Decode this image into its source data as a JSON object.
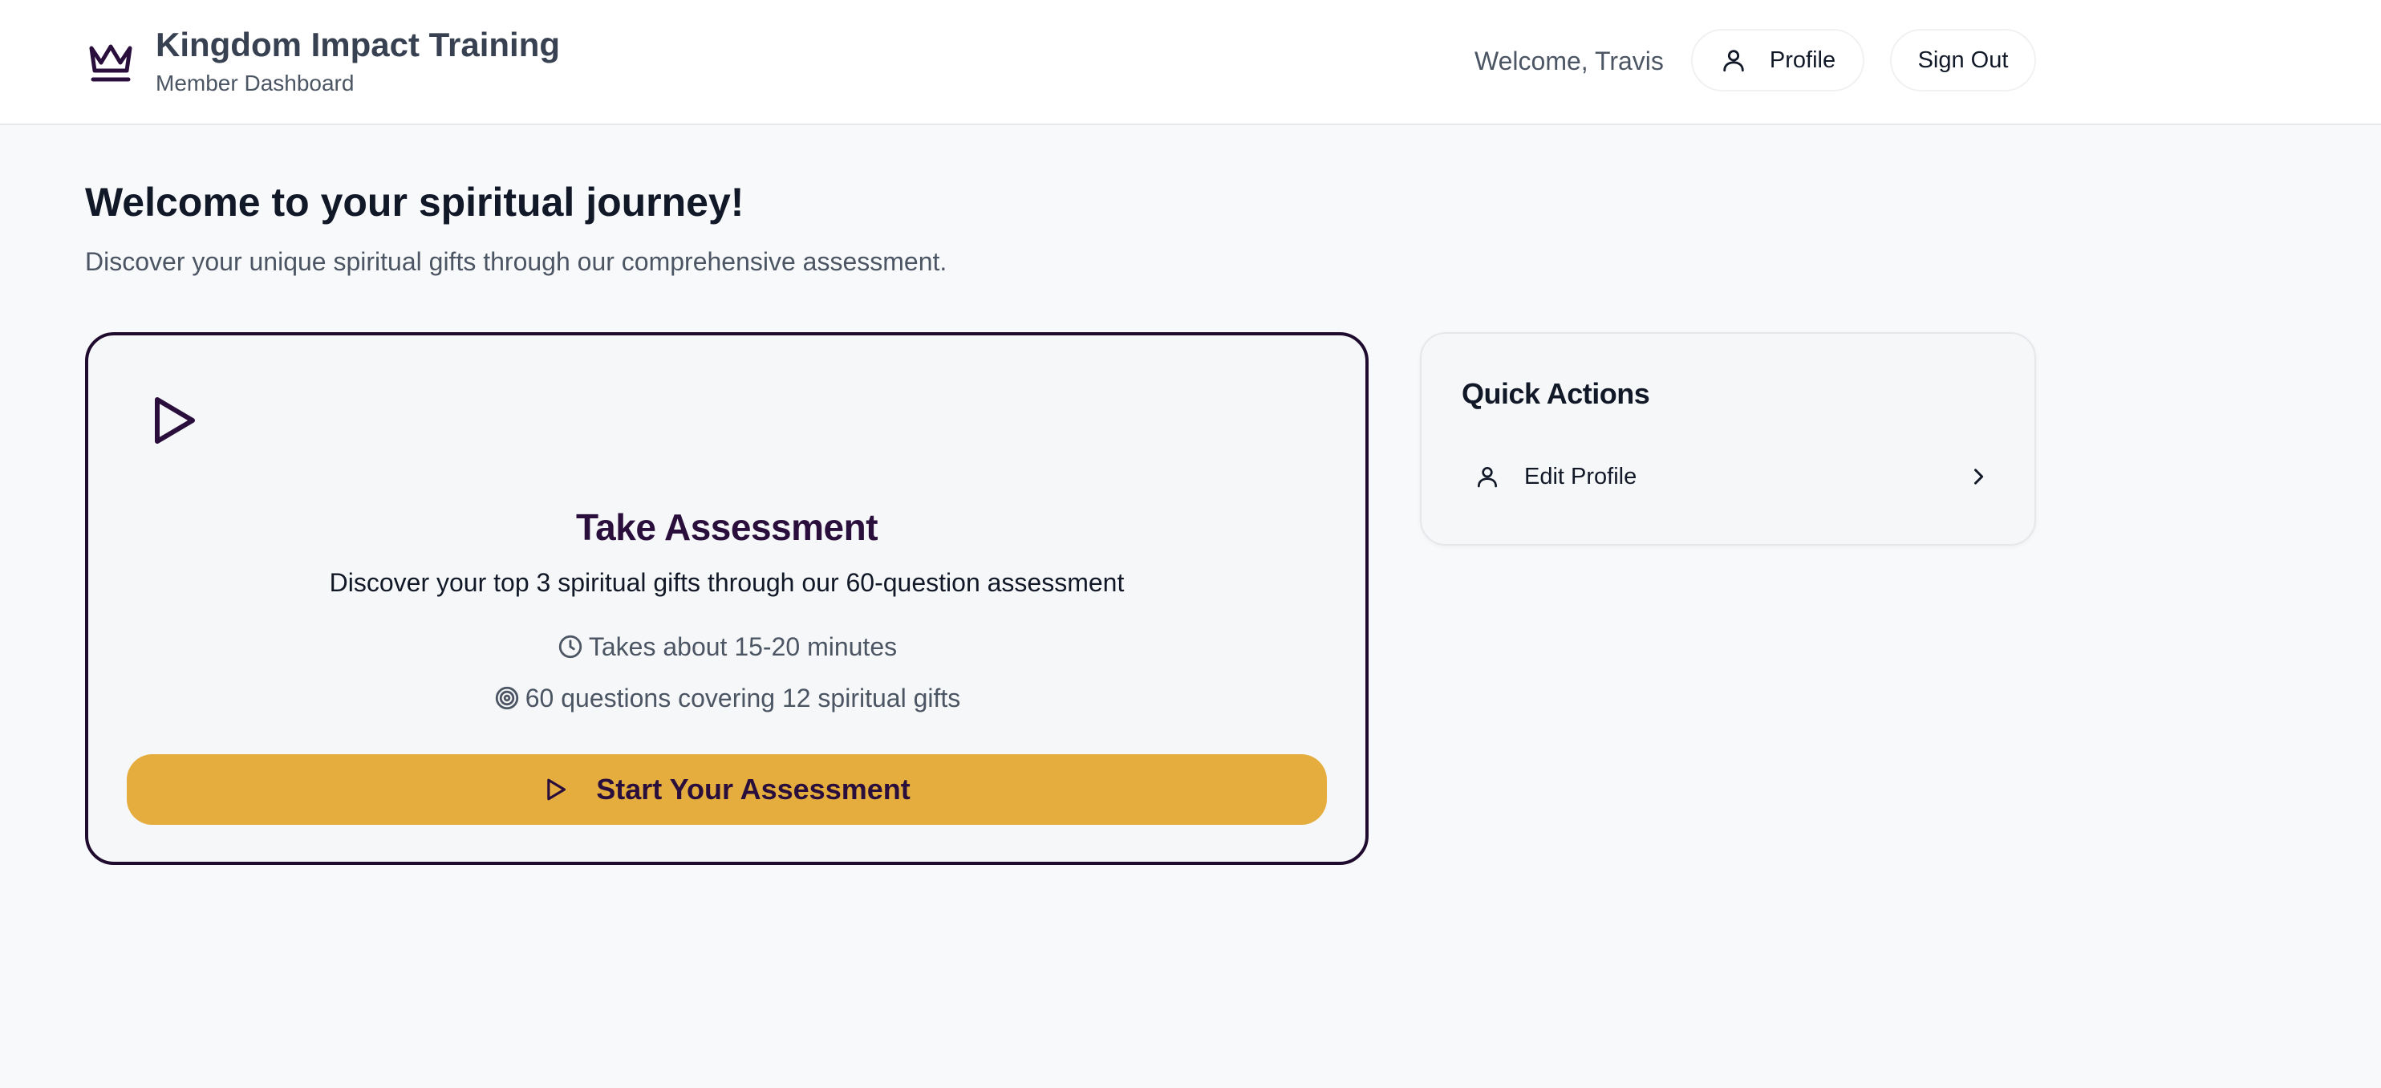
{
  "header": {
    "brand_title": "Kingdom Impact Training",
    "brand_subtitle": "Member Dashboard",
    "welcome_text": "Welcome, Travis",
    "profile_label": "Profile",
    "signout_label": "Sign Out",
    "icons": {
      "logo": "crown-icon",
      "profile": "user-icon"
    }
  },
  "main": {
    "title": "Welcome to your spiritual journey!",
    "subtitle": "Discover your unique spiritual gifts through our comprehensive assessment."
  },
  "assessment_card": {
    "icon": "play-icon",
    "title": "Take Assessment",
    "description": "Discover your top 3 spiritual gifts through our 60-question assessment",
    "duration_text": "Takes about 15-20 minutes",
    "questions_text": "60 questions covering 12 spiritual gifts",
    "button_label": "Start Your Assessment"
  },
  "quick_actions": {
    "title": "Quick Actions",
    "items": [
      {
        "label": "Edit Profile",
        "icon": "user-icon"
      }
    ]
  },
  "colors": {
    "accent": "#e4ad3e",
    "brand_dark": "#2a0f3d",
    "background": "#f8f9fa"
  }
}
